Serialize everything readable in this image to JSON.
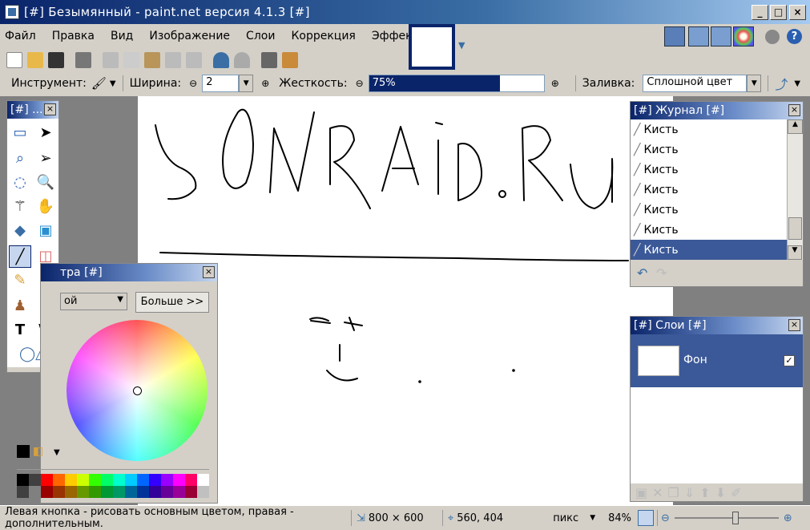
{
  "window": {
    "title": "[#] Безымянный - paint.net версия 4.1.3 [#]"
  },
  "menu": [
    "Файл",
    "Правка",
    "Вид",
    "Изображение",
    "Слои",
    "Коррекция",
    "Эффекты"
  ],
  "options": {
    "tool_label": "Инструмент:",
    "width_label": "Ширина:",
    "width_value": "2",
    "hardness_label": "Жесткость:",
    "hardness_value": "75%",
    "hardness_level": 0.75,
    "fill_label": "Заливка:",
    "fill_value": "Сплошной цвет"
  },
  "tools_panel": {
    "title": "[#] ..."
  },
  "palette_panel": {
    "title": "тра [#]",
    "dropdown_value": "ой",
    "more_button": "Больше >>"
  },
  "history_panel": {
    "title": "[#] Журнал [#]",
    "items": [
      "Кисть",
      "Кисть",
      "Кисть",
      "Кисть",
      "Кисть",
      "Кисть",
      "Кисть"
    ]
  },
  "layers_panel": {
    "title": "[#] Слои [#]",
    "layer_name": "Фон"
  },
  "status": {
    "hint": "Левая кнопка - рисовать основным цветом, правая - дополнительным.",
    "size": "800 × 600",
    "cursor": "560, 404",
    "units": "пикс",
    "zoom": "84%"
  },
  "colors": {
    "accent": "#0a246a",
    "selection": "#3b5998"
  }
}
